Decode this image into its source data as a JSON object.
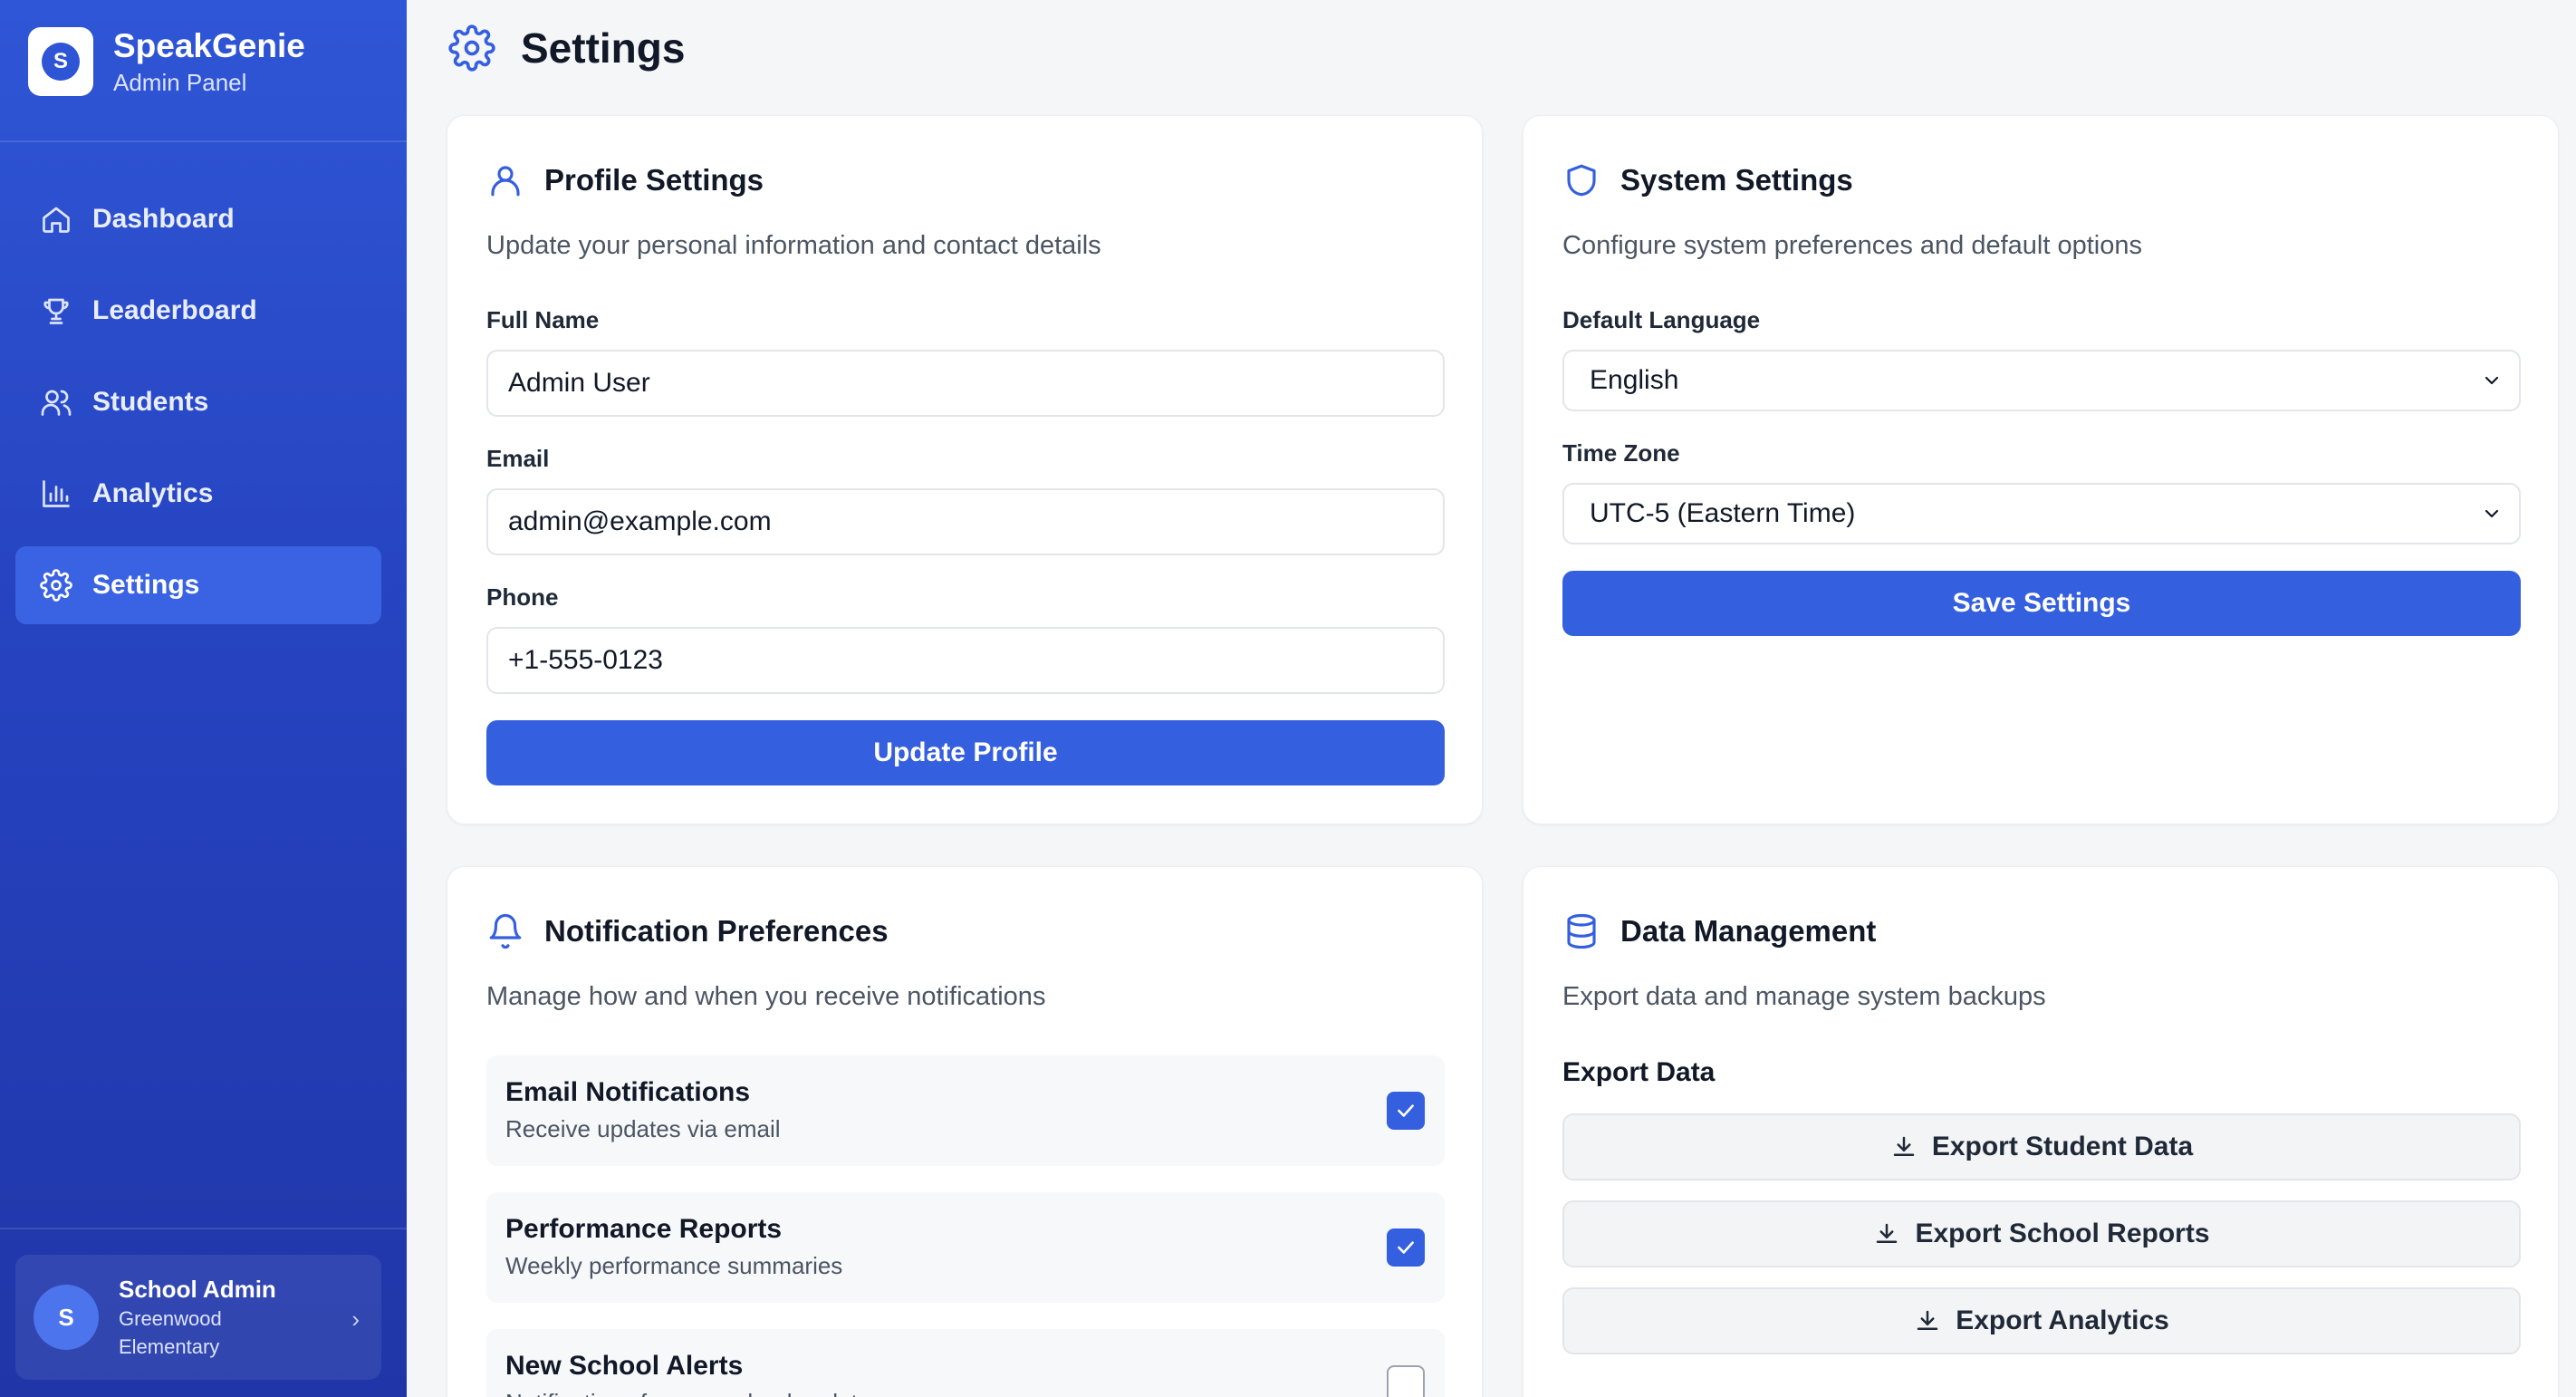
{
  "brand": {
    "logo_letter": "S",
    "name": "SpeakGenie",
    "subtitle": "Admin Panel"
  },
  "nav": {
    "items": [
      {
        "label": "Dashboard",
        "icon": "home-icon",
        "active": false
      },
      {
        "label": "Leaderboard",
        "icon": "trophy-icon",
        "active": false
      },
      {
        "label": "Students",
        "icon": "users-icon",
        "active": false
      },
      {
        "label": "Analytics",
        "icon": "bar-chart-icon",
        "active": false
      },
      {
        "label": "Settings",
        "icon": "gear-icon",
        "active": true
      }
    ]
  },
  "user": {
    "initial": "S",
    "name": "School Admin",
    "school_line1": "Greenwood",
    "school_line2": "Elementary",
    "chevron": "›"
  },
  "header": {
    "title": "Settings"
  },
  "profile": {
    "title": "Profile Settings",
    "description": "Update your personal information and contact details",
    "full_name_label": "Full Name",
    "full_name_value": "Admin User",
    "email_label": "Email",
    "email_value": "admin@example.com",
    "phone_label": "Phone",
    "phone_value": "+1-555-0123",
    "submit_label": "Update Profile"
  },
  "system": {
    "title": "System Settings",
    "description": "Configure system preferences and default options",
    "language_label": "Default Language",
    "language_value": "English",
    "timezone_label": "Time Zone",
    "timezone_value": "UTC-5 (Eastern Time)",
    "submit_label": "Save Settings"
  },
  "notifications": {
    "title": "Notification Preferences",
    "description": "Manage how and when you receive notifications",
    "items": [
      {
        "title": "Email Notifications",
        "subtitle": "Receive updates via email",
        "checked": true
      },
      {
        "title": "Performance Reports",
        "subtitle": "Weekly performance summaries",
        "checked": true
      },
      {
        "title": "New School Alerts",
        "subtitle": "Notifications for new school updates",
        "checked": false
      }
    ]
  },
  "data_management": {
    "title": "Data Management",
    "description": "Export data and manage system backups",
    "export_heading": "Export Data",
    "buttons": [
      {
        "label": "Export Student Data"
      },
      {
        "label": "Export School Reports"
      },
      {
        "label": "Export Analytics"
      }
    ]
  },
  "colors": {
    "primary": "#345fdf",
    "sidebar": "#2643c0",
    "background": "#f5f6f8"
  }
}
